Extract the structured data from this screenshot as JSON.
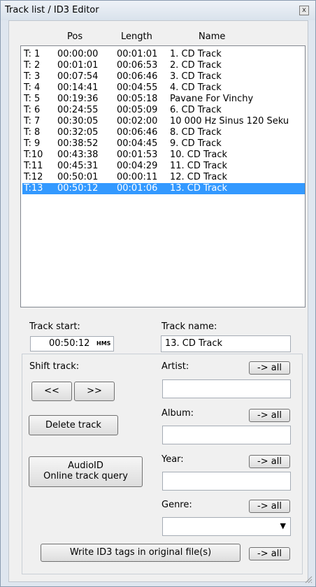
{
  "window": {
    "title": "Track list / ID3 Editor",
    "close_label": "x"
  },
  "columns": {
    "pos": "Pos",
    "length": "Length",
    "name": "Name"
  },
  "tracks": [
    {
      "num": "T: 1",
      "pos": "00:00:00",
      "length": "00:01:01",
      "name": "1. CD Track"
    },
    {
      "num": "T: 2",
      "pos": "00:01:01",
      "length": "00:06:53",
      "name": "2. CD Track"
    },
    {
      "num": "T: 3",
      "pos": "00:07:54",
      "length": "00:06:46",
      "name": "3. CD Track"
    },
    {
      "num": "T: 4",
      "pos": "00:14:41",
      "length": "00:04:55",
      "name": "4. CD Track"
    },
    {
      "num": "T: 5",
      "pos": "00:19:36",
      "length": "00:05:18",
      "name": "Pavane For Vinchy"
    },
    {
      "num": "T: 6",
      "pos": "00:24:55",
      "length": "00:05:09",
      "name": "6. CD Track"
    },
    {
      "num": "T: 7",
      "pos": "00:30:05",
      "length": "00:02:00",
      "name": "10 000 Hz Sinus 120 Seku"
    },
    {
      "num": "T: 8",
      "pos": "00:32:05",
      "length": "00:06:46",
      "name": "8. CD Track"
    },
    {
      "num": "T: 9",
      "pos": "00:38:52",
      "length": "00:04:45",
      "name": "9. CD Track"
    },
    {
      "num": "T:10",
      "pos": "00:43:38",
      "length": "00:01:53",
      "name": "10. CD Track"
    },
    {
      "num": "T:11",
      "pos": "00:45:31",
      "length": "00:04:29",
      "name": "11. CD Track"
    },
    {
      "num": "T:12",
      "pos": "00:50:01",
      "length": "00:00:11",
      "name": "12. CD Track"
    },
    {
      "num": "T:13",
      "pos": "00:50:12",
      "length": "00:01:06",
      "name": "13. CD Track",
      "selected": true
    }
  ],
  "track_start": {
    "label": "Track start:",
    "value": "00:50:12",
    "unit": "HMS"
  },
  "track_name": {
    "label": "Track name:",
    "value": "13. CD Track"
  },
  "shift": {
    "label": "Shift track:",
    "back": "<<",
    "fwd": ">>"
  },
  "delete_label": "Delete track",
  "audioid": {
    "line1": "AudioID",
    "line2": "Online track query"
  },
  "artist": {
    "label": "Artist:",
    "value": ""
  },
  "album": {
    "label": "Album:",
    "value": ""
  },
  "year": {
    "label": "Year:",
    "value": ""
  },
  "genre": {
    "label": "Genre:",
    "value": ""
  },
  "apply_all": "-> all",
  "write_label": "Write ID3 tags in original file(s)"
}
